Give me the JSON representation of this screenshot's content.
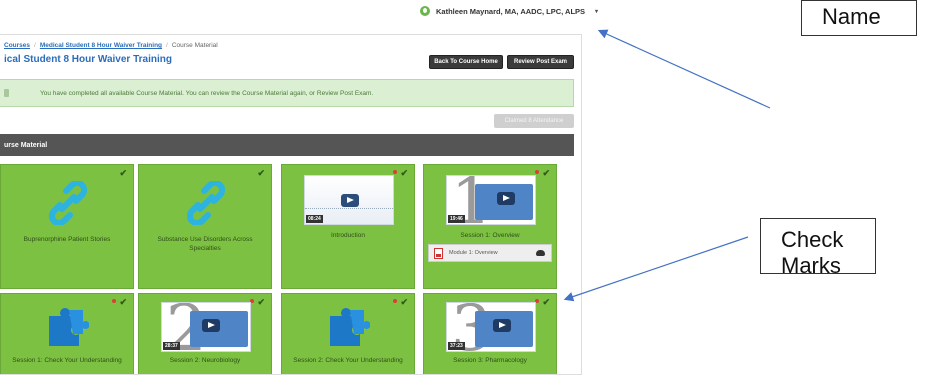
{
  "user": {
    "name": "Kathleen Maynard, MA, AADC, LPC, ALPS",
    "caret": "▾"
  },
  "breadcrumb": {
    "item1": "Courses",
    "item2": "Medical Student 8 Hour Waiver Training",
    "item3": "Course Material",
    "separator": "/"
  },
  "page": {
    "title": "ical Student 8 Hour Waiver Training"
  },
  "buttons": {
    "back_home": "Back To Course Home",
    "review_post": "Review Post Exam",
    "claim": "Claimed 8 Attendance"
  },
  "alert": {
    "text": "You have completed all available Course Material. You can review the Course Material again, or Review Post Exam."
  },
  "section": {
    "title": "urse Material"
  },
  "tiles": [
    {
      "label": "Buprenorphine Patient Stories",
      "check": "✔"
    },
    {
      "label": "Substance Use Disorders Across Specialties",
      "check": "✔"
    },
    {
      "label": "Introduction",
      "check": "✔",
      "duration": "08:24"
    },
    {
      "label": "Session 1: Overview",
      "check": "✔",
      "duration": "19:46",
      "attachment": "Module 1: Overview",
      "number": "1"
    },
    {
      "label": "Session 1: Check Your Understanding",
      "check": "✔"
    },
    {
      "label": "Session 2: Neurobiology",
      "check": "✔",
      "duration": "28:37",
      "number": "2"
    },
    {
      "label": "Session 2: Check Your Understanding",
      "check": "✔"
    },
    {
      "label": "Session 3: Pharmacology",
      "check": "✔",
      "duration": "37:23",
      "number": "3"
    }
  ],
  "annotations": {
    "name": "Name",
    "check_line1": "Check",
    "check_line2": "Marks"
  },
  "colors": {
    "tile_green": "#7dc142",
    "accent_blue": "#2a6ebb",
    "dark_button": "#3b3b3b",
    "arrow": "#4472c4"
  }
}
